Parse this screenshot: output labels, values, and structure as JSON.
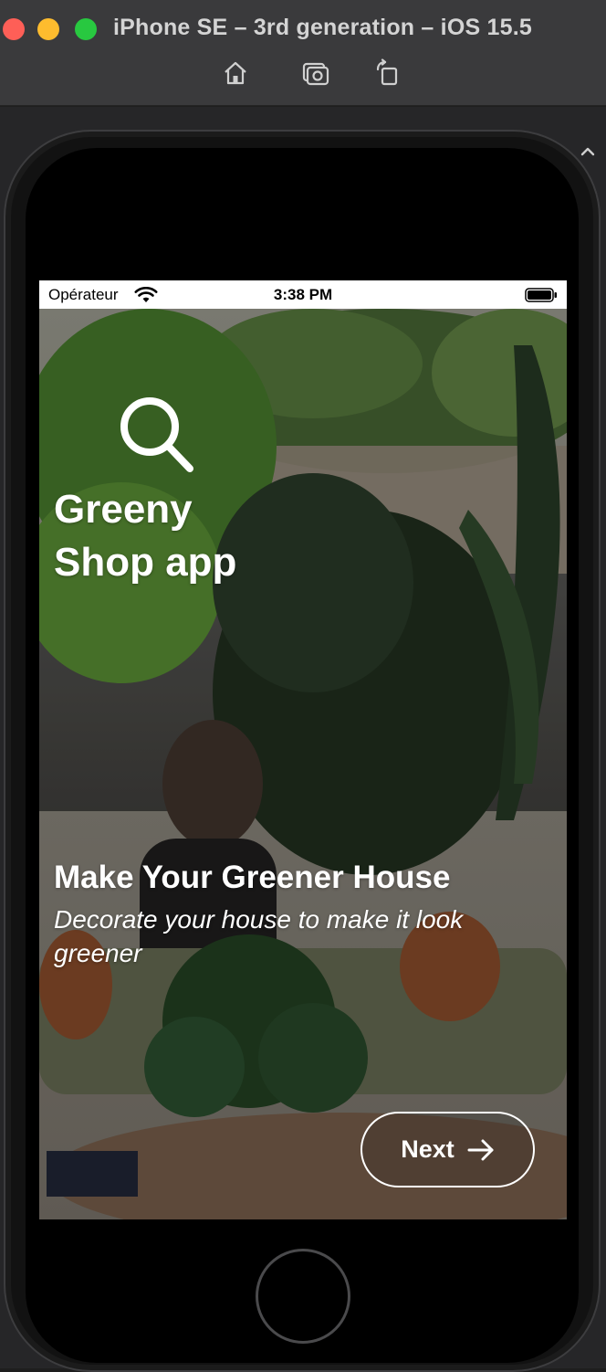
{
  "window": {
    "title": "iPhone SE – 3rd generation – iOS 15.5",
    "controls": [
      "close",
      "minimize",
      "zoom"
    ],
    "toolbar_icons": [
      "home-icon",
      "screenshot-icon",
      "rotate-icon"
    ]
  },
  "status_bar": {
    "carrier": "Opérateur",
    "time": "3:38 PM",
    "icons": [
      "wifi-icon",
      "battery-icon"
    ]
  },
  "onboarding": {
    "logo_icon": "search-icon",
    "app_title_line1": "Greeny",
    "app_title_line2": "Shop app",
    "headline": "Make Your Greener House",
    "subtitle": "Decorate your house to make it look greener",
    "next_button_label": "Next",
    "next_button_icon": "arrow-right-icon"
  },
  "colors": {
    "title_bar": "#3a3a3c",
    "close": "#fe5f57",
    "minimize": "#febc2e",
    "zoom": "#28c840",
    "text_on_photo": "#ffffff"
  }
}
